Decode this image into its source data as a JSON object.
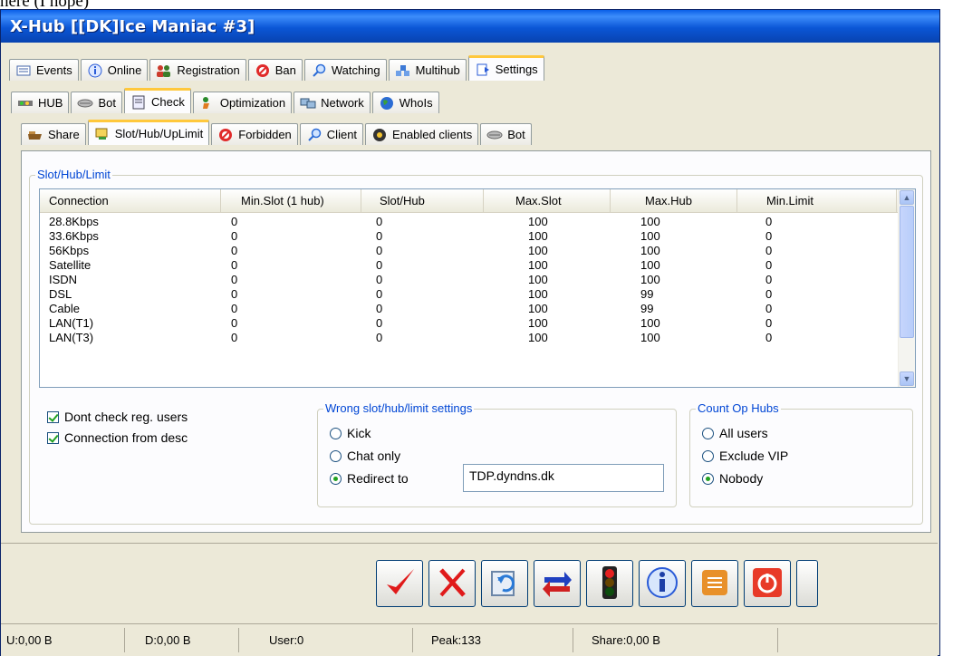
{
  "above_text": "here (I hope)",
  "window": {
    "title": "X-Hub [[DK]Ice Maniac #3]"
  },
  "main_tabs": [
    {
      "label": "Events",
      "icon": "events-icon"
    },
    {
      "label": "Online",
      "icon": "info-icon"
    },
    {
      "label": "Registration",
      "icon": "users-icon"
    },
    {
      "label": "Ban",
      "icon": "ban-icon"
    },
    {
      "label": "Watching",
      "icon": "magnifier-icon"
    },
    {
      "label": "Multihub",
      "icon": "multihub-icon"
    },
    {
      "label": "Settings",
      "icon": "settings-icon",
      "active": true
    }
  ],
  "settings_tabs": [
    {
      "label": "HUB",
      "icon": "hub-icon"
    },
    {
      "label": "Bot",
      "icon": "bot-icon"
    },
    {
      "label": "Check",
      "icon": "check-icon",
      "active": true
    },
    {
      "label": "Optimization",
      "icon": "optimization-icon"
    },
    {
      "label": "Network",
      "icon": "network-icon"
    },
    {
      "label": "WhoIs",
      "icon": "globe-icon"
    }
  ],
  "check_tabs": [
    {
      "label": "Share",
      "icon": "share-icon"
    },
    {
      "label": "Slot/Hub/UpLimit",
      "icon": "slot-icon",
      "active": true
    },
    {
      "label": "Forbidden",
      "icon": "forbidden-icon"
    },
    {
      "label": "Client",
      "icon": "client-icon"
    },
    {
      "label": "Enabled clients",
      "icon": "enabled-clients-icon"
    },
    {
      "label": "Bot",
      "icon": "bot-icon"
    }
  ],
  "slot_group": {
    "legend": "Slot/Hub/Limit",
    "columns": [
      "Connection",
      "Min.Slot (1 hub)",
      "Slot/Hub",
      "Max.Slot",
      "Max.Hub",
      "Min.Limit"
    ],
    "rows": [
      [
        "28.8Kbps",
        "0",
        "0",
        "100",
        "100",
        "0"
      ],
      [
        "33.6Kbps",
        "0",
        "0",
        "100",
        "100",
        "0"
      ],
      [
        "56Kbps",
        "0",
        "0",
        "100",
        "100",
        "0"
      ],
      [
        "Satellite",
        "0",
        "0",
        "100",
        "100",
        "0"
      ],
      [
        "ISDN",
        "0",
        "0",
        "100",
        "100",
        "0"
      ],
      [
        "DSL",
        "0",
        "0",
        "100",
        "99",
        "0"
      ],
      [
        "Cable",
        "0",
        "0",
        "100",
        "99",
        "0"
      ],
      [
        "LAN(T1)",
        "0",
        "0",
        "100",
        "100",
        "0"
      ],
      [
        "LAN(T3)",
        "0",
        "0",
        "100",
        "100",
        "0"
      ]
    ]
  },
  "options": {
    "dont_check_reg": {
      "label": "Dont check reg. users",
      "checked": true
    },
    "connection_from_desc": {
      "label": "Connection from desc",
      "checked": true
    }
  },
  "wrong_settings": {
    "legend": "Wrong slot/hub/limit settings",
    "kick": "Kick",
    "chat_only": "Chat only",
    "redirect_to": "Redirect to",
    "selected": "redirect_to",
    "redirect_value": "TDP.dyndns.dk"
  },
  "count_op_hubs": {
    "legend": "Count Op Hubs",
    "all_users": "All users",
    "exclude_vip": "Exclude VIP",
    "nobody": "Nobody",
    "selected": "nobody"
  },
  "toolbar": {
    "buttons": [
      "apply-button",
      "cancel-button",
      "reload-button",
      "swap-button",
      "traffic-light-button",
      "info-button",
      "log-button",
      "power-button"
    ]
  },
  "status": {
    "upload": "U:0,00 B",
    "download": "D:0,00 B",
    "users": "User:0",
    "peak": "Peak:133",
    "share": "Share:0,00 B"
  },
  "colors": {
    "accent": "#0046d5",
    "title": "#0a5fe8",
    "check": "#21a121",
    "tab_highlight": "#ffc83c"
  }
}
